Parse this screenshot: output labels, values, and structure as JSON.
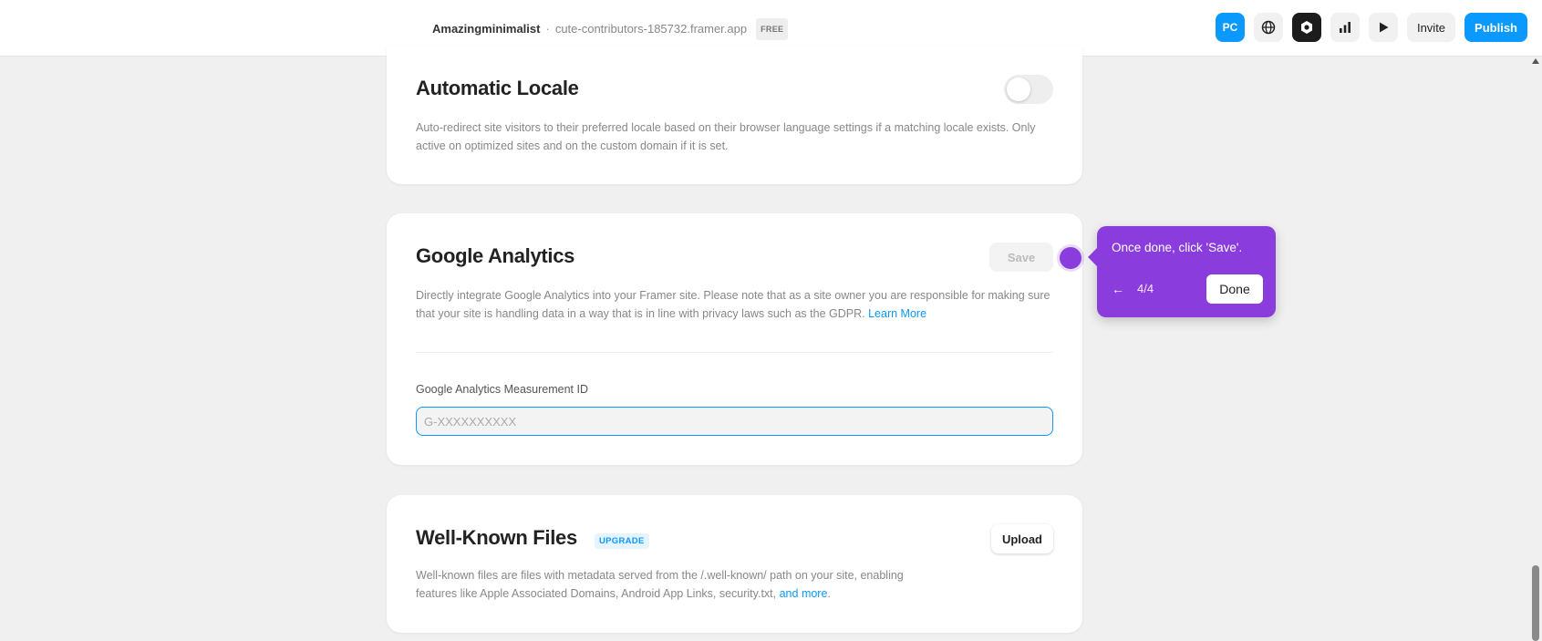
{
  "topbar": {
    "project_name": "Amazingminimalist",
    "separator": "·",
    "domain": "cute-contributors-185732.framer.app",
    "plan_badge": "FREE",
    "device_label": "PC",
    "invite_label": "Invite",
    "publish_label": "Publish",
    "icons": [
      "globe-icon",
      "hexagon-icon",
      "bar-chart-icon",
      "play-icon"
    ]
  },
  "automatic_locale": {
    "title": "Automatic Locale",
    "description": "Auto-redirect site visitors to their preferred locale based on their browser language settings if a matching locale exists. Only active on optimized sites and on the custom domain if it is set.",
    "enabled": false
  },
  "google_analytics": {
    "title": "Google Analytics",
    "save_label": "Save",
    "description": "Directly integrate Google Analytics into your Framer site. Please note that as a site owner you are responsible for making sure that your site is handling data in a way that is in line with privacy laws such as the GDPR.",
    "learn_more": "Learn More",
    "field_label": "Google Analytics Measurement ID",
    "field_value": "",
    "field_placeholder": "G-XXXXXXXXXX"
  },
  "well_known_files": {
    "title": "Well-Known Files",
    "badge": "UPGRADE",
    "upload_label": "Upload",
    "description": "Well-known files are files with metadata served from the /.well-known/ path on your site, enabling features like Apple Associated Domains, Android App Links, security.txt,",
    "and_more": "and more",
    "trailing": "."
  },
  "guide": {
    "message": "Once done, click 'Save'.",
    "back_icon": "←",
    "step": "4/4",
    "done_label": "Done"
  },
  "colors": {
    "accent": "#0a99ff",
    "guide": "#8a3ddc"
  }
}
